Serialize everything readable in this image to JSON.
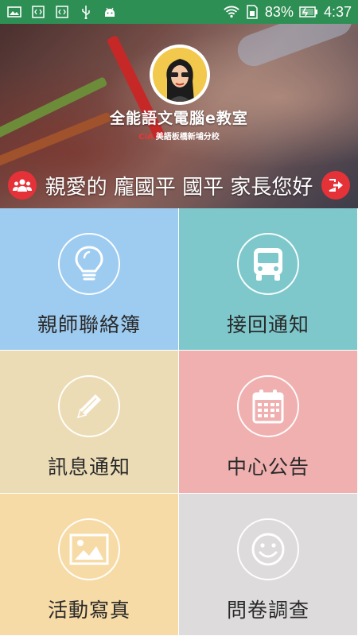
{
  "status_bar": {
    "battery_percent": "83%",
    "time": "4:37",
    "icons": [
      "image-icon",
      "code-icon",
      "code-icon",
      "usb-icon",
      "android-icon",
      "wifi-icon",
      "sim-icon",
      "battery-icon"
    ]
  },
  "header": {
    "title": "全能語文電腦e教室",
    "subtitle_tag": "CiA",
    "subtitle": "美語板橋新埔分校",
    "greeting": "親愛的 龐國平 國平 家長您好",
    "left_icon": "group-icon",
    "right_icon": "logout-icon"
  },
  "tiles": [
    {
      "label": "親師聯絡簿",
      "icon": "lightbulb-icon",
      "color": "#9ecbf0"
    },
    {
      "label": "接回通知",
      "icon": "bus-icon",
      "color": "#7ec8cb"
    },
    {
      "label": "訊息通知",
      "icon": "pencil-icon",
      "color": "#ecdcb6"
    },
    {
      "label": "中心公告",
      "icon": "calendar-icon",
      "color": "#f0b0b0"
    },
    {
      "label": "活動寫真",
      "icon": "picture-icon",
      "color": "#f7dba6"
    },
    {
      "label": "問卷調查",
      "icon": "smiley-icon",
      "color": "#dedbdc"
    }
  ],
  "colors": {
    "status_bar": "#2e8f54",
    "accent_red": "#e53238"
  }
}
